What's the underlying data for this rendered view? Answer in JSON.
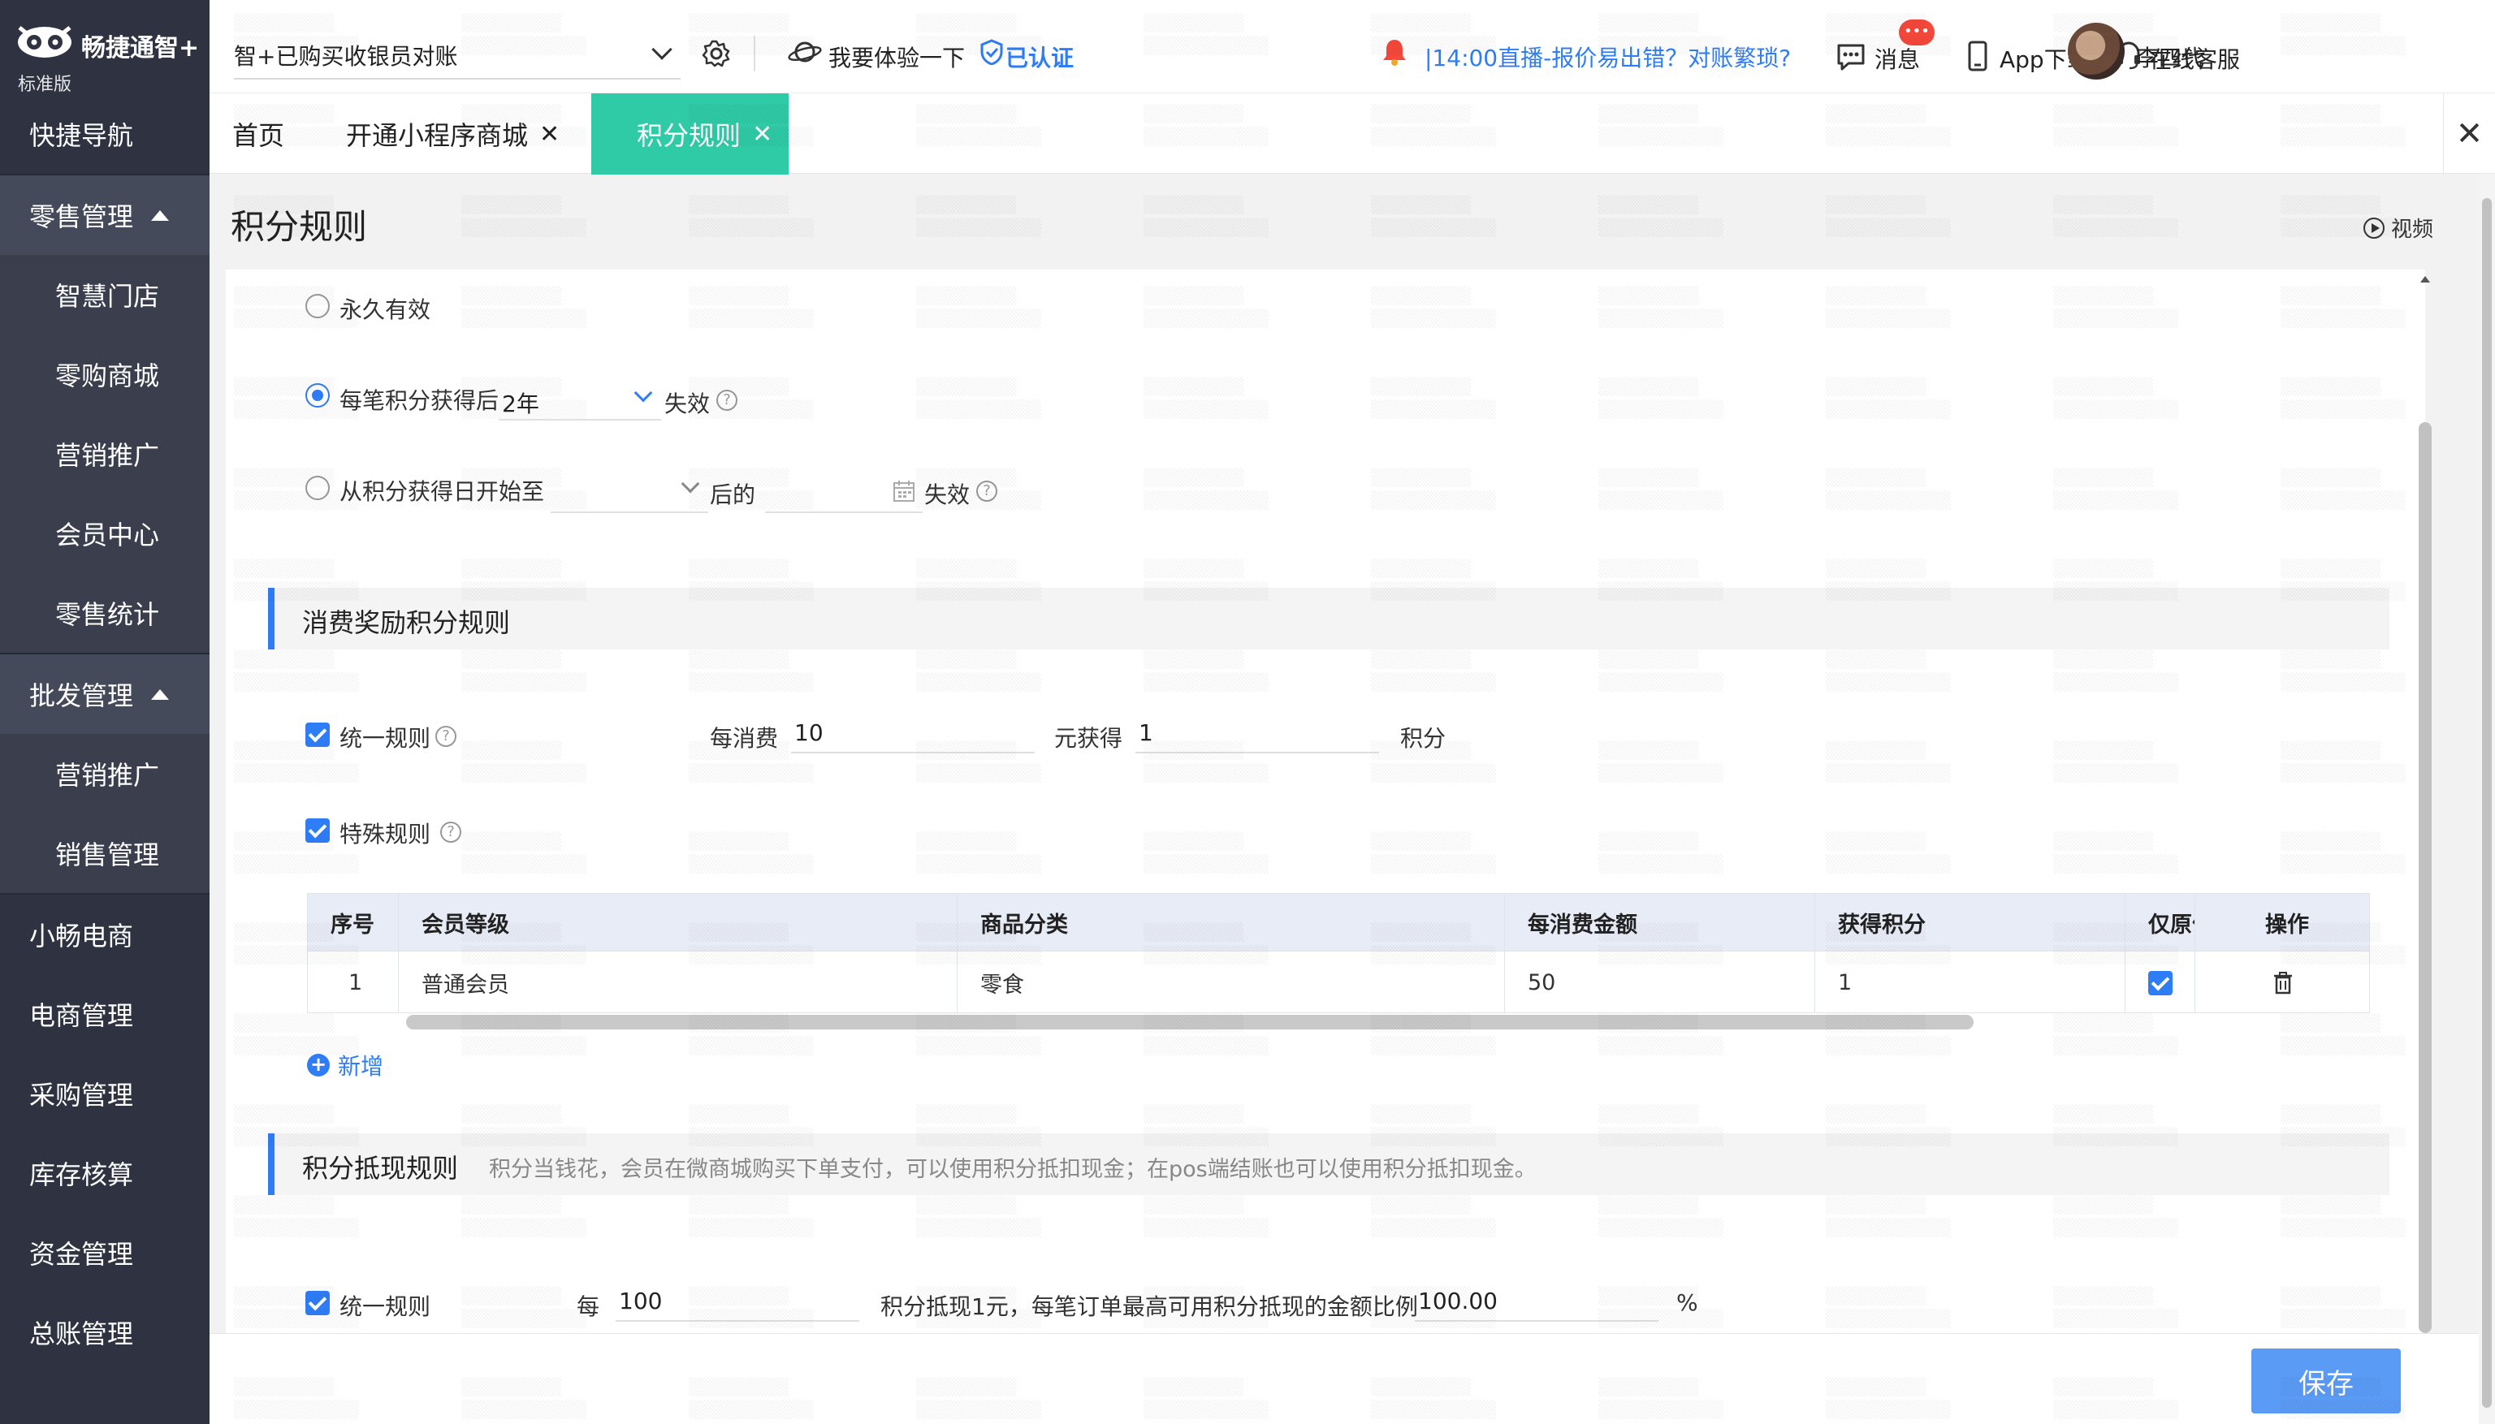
{
  "app": {
    "brand": "畅捷通智+",
    "edition": "标准版"
  },
  "sidebar": {
    "items": [
      {
        "label": "快捷导航",
        "type": "group"
      },
      {
        "label": "零售管理",
        "type": "header",
        "expanded": true
      },
      {
        "label": "智慧门店",
        "type": "sub"
      },
      {
        "label": "零购商城",
        "type": "sub"
      },
      {
        "label": "营销推广",
        "type": "sub"
      },
      {
        "label": "会员中心",
        "type": "sub"
      },
      {
        "label": "零售统计",
        "type": "sub"
      },
      {
        "label": "批发管理",
        "type": "header",
        "expanded": true
      },
      {
        "label": "营销推广",
        "type": "sub"
      },
      {
        "label": "销售管理",
        "type": "sub"
      },
      {
        "label": "小畅电商",
        "type": "group"
      },
      {
        "label": "电商管理",
        "type": "group"
      },
      {
        "label": "采购管理",
        "type": "group"
      },
      {
        "label": "库存核算",
        "type": "group"
      },
      {
        "label": "资金管理",
        "type": "group"
      },
      {
        "label": "总账管理",
        "type": "group"
      }
    ]
  },
  "topbar": {
    "account": "智+已购买收银员对账",
    "try_label": "我要体验一下",
    "certified": "已认证",
    "live": "|14:00直播-报价易出错？对账繁琐?",
    "messages": "消息",
    "messages_badge": "•••",
    "app_download": "App下载",
    "support": "在线客服",
    "user": "李四代"
  },
  "tabs": [
    {
      "label": "首页",
      "closable": false,
      "active": false
    },
    {
      "label": "开通小程序商城",
      "closable": true,
      "active": false
    },
    {
      "label": "积分规则",
      "closable": true,
      "active": true
    }
  ],
  "page": {
    "title": "积分规则",
    "video": "视频"
  },
  "expiry": {
    "forever": "永久有效",
    "after_each_prefix": "每笔积分获得后",
    "after_each_value": "2年",
    "after_each_suffix": "失效",
    "from_date_prefix": "从积分获得日开始至",
    "from_date_mid": "后的",
    "from_date_suffix": "失效",
    "selected": "after_each"
  },
  "reward_section": {
    "title": "消费奖励积分规则",
    "unified_label": "统一规则",
    "per_spend_label": "每消费",
    "per_spend_value": "10",
    "get_label": "元获得",
    "get_value": "1",
    "points_label": "积分",
    "special_label": "特殊规则"
  },
  "table": {
    "columns": [
      "序号",
      "会员等级",
      "商品分类",
      "每消费金额",
      "获得积分",
      "仅原价",
      "操作"
    ],
    "rows": [
      {
        "index": "1",
        "level": "普通会员",
        "category": "零食",
        "amount": "50",
        "points": "1",
        "original_only": true
      }
    ],
    "add_label": "新增"
  },
  "redeem_section": {
    "title": "积分抵现规则",
    "desc": "积分当钱花，会员在微商城购买下单支付，可以使用积分抵扣现金；在pos端结账也可以使用积分抵扣现金。",
    "unified_label": "统一规则",
    "per_label": "每",
    "per_value": "100",
    "ratio_label": "积分抵现1元，每笔订单最高可用积分抵现的金额比例",
    "ratio_value": "100.00",
    "percent": "%"
  },
  "footer": {
    "save": "保存"
  },
  "colors": {
    "sidebar": "#2f3341",
    "accent": "#2fcaa6",
    "primary": "#2f7df6"
  }
}
